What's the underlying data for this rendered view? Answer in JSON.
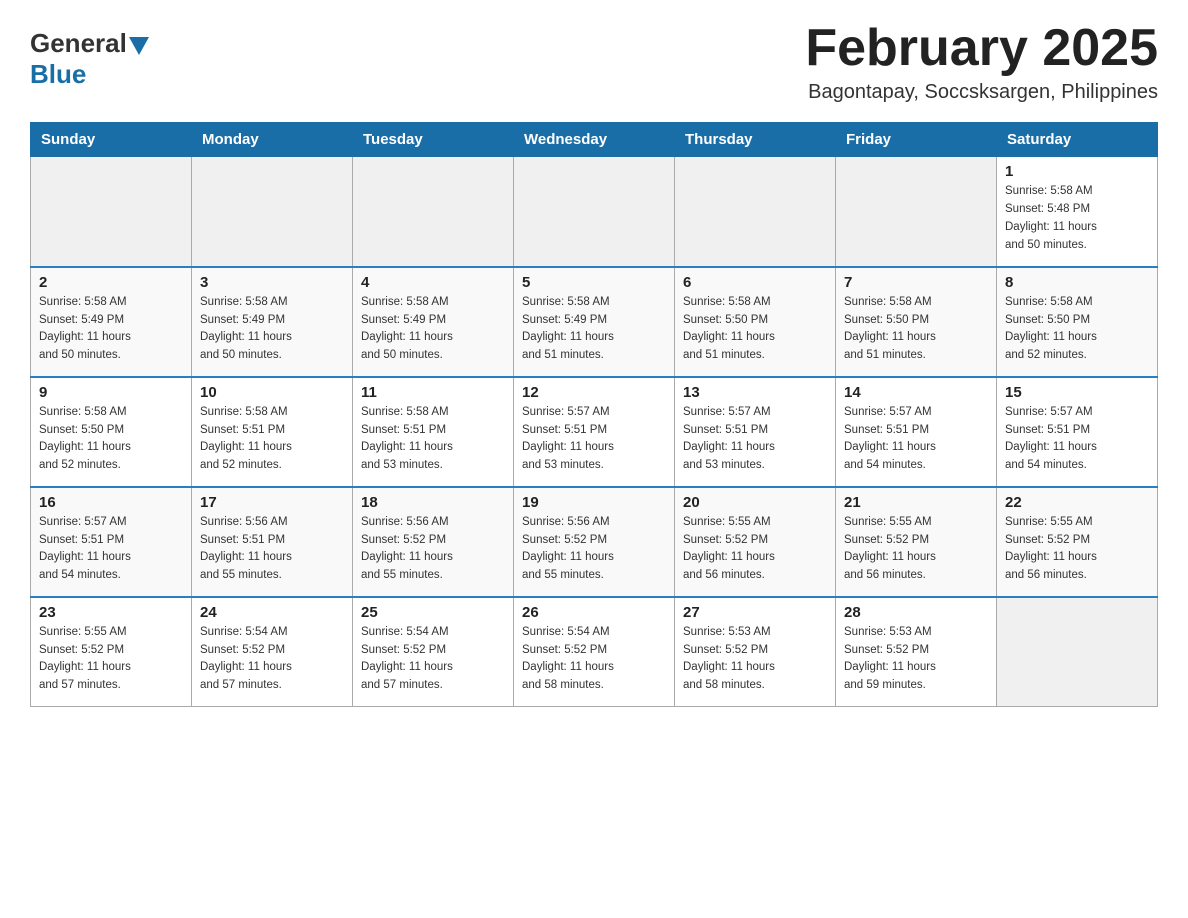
{
  "header": {
    "logo_general": "General",
    "logo_blue": "Blue",
    "month_title": "February 2025",
    "location": "Bagontapay, Soccsksargen, Philippines"
  },
  "days_of_week": [
    "Sunday",
    "Monday",
    "Tuesday",
    "Wednesday",
    "Thursday",
    "Friday",
    "Saturday"
  ],
  "weeks": [
    [
      {
        "day": "",
        "info": ""
      },
      {
        "day": "",
        "info": ""
      },
      {
        "day": "",
        "info": ""
      },
      {
        "day": "",
        "info": ""
      },
      {
        "day": "",
        "info": ""
      },
      {
        "day": "",
        "info": ""
      },
      {
        "day": "1",
        "info": "Sunrise: 5:58 AM\nSunset: 5:48 PM\nDaylight: 11 hours\nand 50 minutes."
      }
    ],
    [
      {
        "day": "2",
        "info": "Sunrise: 5:58 AM\nSunset: 5:49 PM\nDaylight: 11 hours\nand 50 minutes."
      },
      {
        "day": "3",
        "info": "Sunrise: 5:58 AM\nSunset: 5:49 PM\nDaylight: 11 hours\nand 50 minutes."
      },
      {
        "day": "4",
        "info": "Sunrise: 5:58 AM\nSunset: 5:49 PM\nDaylight: 11 hours\nand 50 minutes."
      },
      {
        "day": "5",
        "info": "Sunrise: 5:58 AM\nSunset: 5:49 PM\nDaylight: 11 hours\nand 51 minutes."
      },
      {
        "day": "6",
        "info": "Sunrise: 5:58 AM\nSunset: 5:50 PM\nDaylight: 11 hours\nand 51 minutes."
      },
      {
        "day": "7",
        "info": "Sunrise: 5:58 AM\nSunset: 5:50 PM\nDaylight: 11 hours\nand 51 minutes."
      },
      {
        "day": "8",
        "info": "Sunrise: 5:58 AM\nSunset: 5:50 PM\nDaylight: 11 hours\nand 52 minutes."
      }
    ],
    [
      {
        "day": "9",
        "info": "Sunrise: 5:58 AM\nSunset: 5:50 PM\nDaylight: 11 hours\nand 52 minutes."
      },
      {
        "day": "10",
        "info": "Sunrise: 5:58 AM\nSunset: 5:51 PM\nDaylight: 11 hours\nand 52 minutes."
      },
      {
        "day": "11",
        "info": "Sunrise: 5:58 AM\nSunset: 5:51 PM\nDaylight: 11 hours\nand 53 minutes."
      },
      {
        "day": "12",
        "info": "Sunrise: 5:57 AM\nSunset: 5:51 PM\nDaylight: 11 hours\nand 53 minutes."
      },
      {
        "day": "13",
        "info": "Sunrise: 5:57 AM\nSunset: 5:51 PM\nDaylight: 11 hours\nand 53 minutes."
      },
      {
        "day": "14",
        "info": "Sunrise: 5:57 AM\nSunset: 5:51 PM\nDaylight: 11 hours\nand 54 minutes."
      },
      {
        "day": "15",
        "info": "Sunrise: 5:57 AM\nSunset: 5:51 PM\nDaylight: 11 hours\nand 54 minutes."
      }
    ],
    [
      {
        "day": "16",
        "info": "Sunrise: 5:57 AM\nSunset: 5:51 PM\nDaylight: 11 hours\nand 54 minutes."
      },
      {
        "day": "17",
        "info": "Sunrise: 5:56 AM\nSunset: 5:51 PM\nDaylight: 11 hours\nand 55 minutes."
      },
      {
        "day": "18",
        "info": "Sunrise: 5:56 AM\nSunset: 5:52 PM\nDaylight: 11 hours\nand 55 minutes."
      },
      {
        "day": "19",
        "info": "Sunrise: 5:56 AM\nSunset: 5:52 PM\nDaylight: 11 hours\nand 55 minutes."
      },
      {
        "day": "20",
        "info": "Sunrise: 5:55 AM\nSunset: 5:52 PM\nDaylight: 11 hours\nand 56 minutes."
      },
      {
        "day": "21",
        "info": "Sunrise: 5:55 AM\nSunset: 5:52 PM\nDaylight: 11 hours\nand 56 minutes."
      },
      {
        "day": "22",
        "info": "Sunrise: 5:55 AM\nSunset: 5:52 PM\nDaylight: 11 hours\nand 56 minutes."
      }
    ],
    [
      {
        "day": "23",
        "info": "Sunrise: 5:55 AM\nSunset: 5:52 PM\nDaylight: 11 hours\nand 57 minutes."
      },
      {
        "day": "24",
        "info": "Sunrise: 5:54 AM\nSunset: 5:52 PM\nDaylight: 11 hours\nand 57 minutes."
      },
      {
        "day": "25",
        "info": "Sunrise: 5:54 AM\nSunset: 5:52 PM\nDaylight: 11 hours\nand 57 minutes."
      },
      {
        "day": "26",
        "info": "Sunrise: 5:54 AM\nSunset: 5:52 PM\nDaylight: 11 hours\nand 58 minutes."
      },
      {
        "day": "27",
        "info": "Sunrise: 5:53 AM\nSunset: 5:52 PM\nDaylight: 11 hours\nand 58 minutes."
      },
      {
        "day": "28",
        "info": "Sunrise: 5:53 AM\nSunset: 5:52 PM\nDaylight: 11 hours\nand 59 minutes."
      },
      {
        "day": "",
        "info": ""
      }
    ]
  ]
}
